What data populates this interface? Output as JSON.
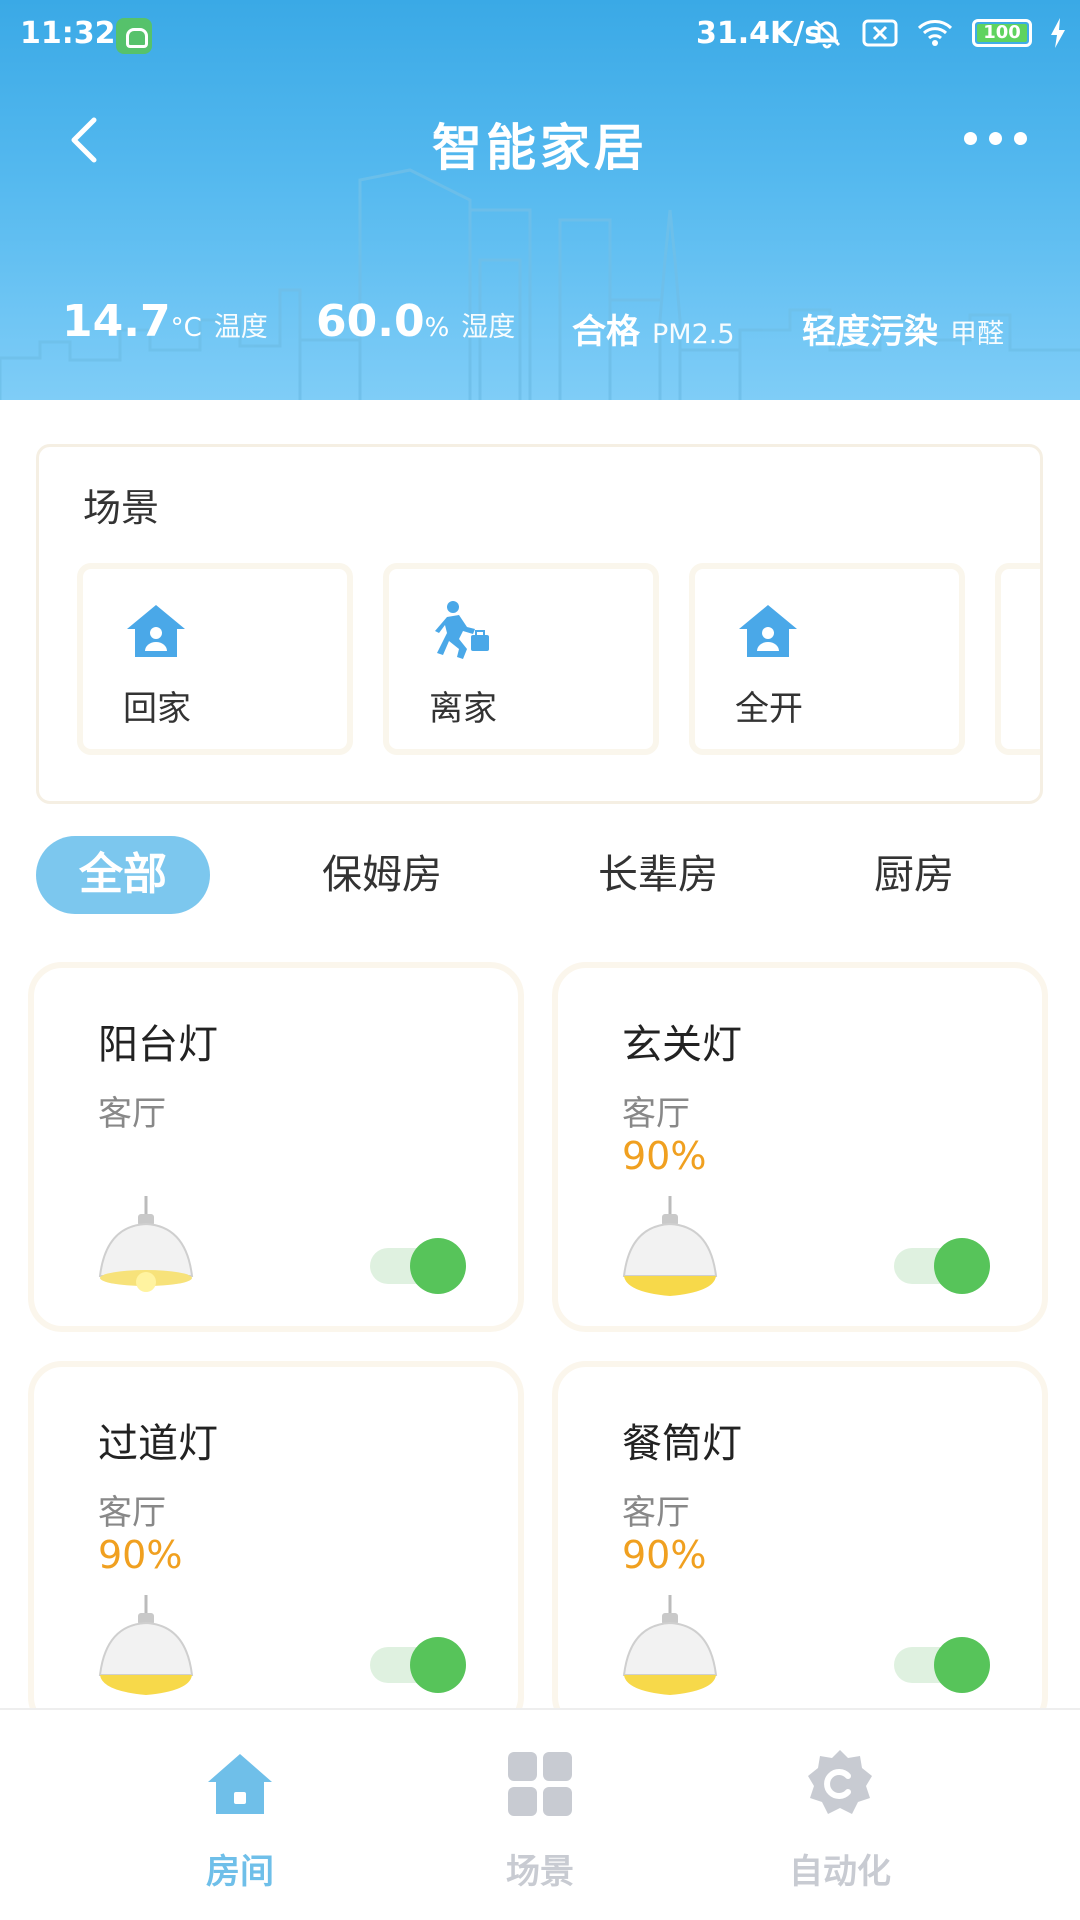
{
  "status_bar": {
    "time": "11:32",
    "net_speed": "31.4K/s",
    "battery": "100"
  },
  "topbar": {
    "title": "智能家居"
  },
  "env": {
    "temperature": {
      "value": "14.7",
      "unit": "°C",
      "label": "温度"
    },
    "humidity": {
      "value": "60.0",
      "unit": "%",
      "label": "湿度"
    },
    "pm25": {
      "value": "合格",
      "label": "PM2.5"
    },
    "formaldehyde": {
      "value": "轻度污染",
      "label": "甲醛"
    }
  },
  "scenes": {
    "title": "场景",
    "items": [
      {
        "label": "回家",
        "icon": "home-person-icon"
      },
      {
        "label": "离家",
        "icon": "walking-person-icon"
      },
      {
        "label": "全开",
        "icon": "home-person-icon"
      }
    ]
  },
  "room_tabs": [
    {
      "label": "全部",
      "active": true
    },
    {
      "label": "保姆房",
      "active": false
    },
    {
      "label": "长辈房",
      "active": false
    },
    {
      "label": "厨房",
      "active": false
    }
  ],
  "devices": [
    {
      "name": "阳台灯",
      "room": "客厅",
      "level": "",
      "on": true
    },
    {
      "name": "玄关灯",
      "room": "客厅",
      "level": "90%",
      "on": true
    },
    {
      "name": "过道灯",
      "room": "客厅",
      "level": "90%",
      "on": true
    },
    {
      "name": "餐筒灯",
      "room": "客厅",
      "level": "90%",
      "on": true
    }
  ],
  "bottom_nav": [
    {
      "label": "房间",
      "icon": "house-icon",
      "active": true
    },
    {
      "label": "场景",
      "icon": "grid-icon",
      "active": false
    },
    {
      "label": "自动化",
      "icon": "gear-icon",
      "active": false
    }
  ],
  "colors": {
    "header_blue": "#3aa9e6",
    "accent_blue": "#6fbfe9",
    "switch_green": "#57c45a",
    "level_orange": "#f0a020",
    "inactive_gray": "#c8cbd2"
  }
}
